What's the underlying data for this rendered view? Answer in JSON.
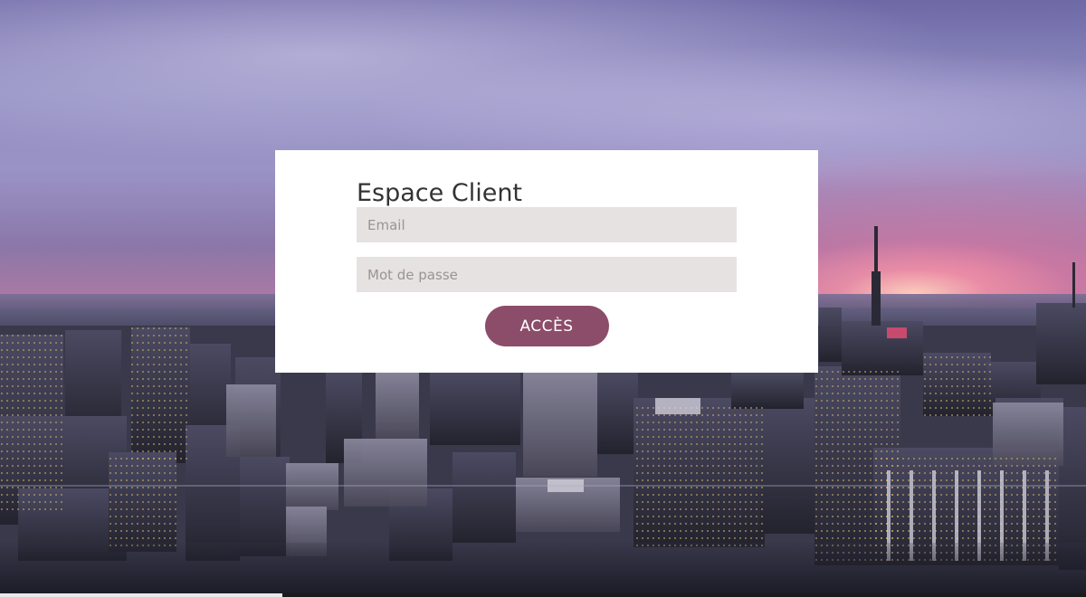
{
  "login": {
    "title": "Espace Client",
    "email": {
      "value": "",
      "placeholder": "Email"
    },
    "password": {
      "value": "",
      "placeholder": "Mot de passe"
    },
    "submit_label": "ACCÈS"
  },
  "colors": {
    "card_background": "#ffffff",
    "input_background": "#e6e2e2",
    "button_background": "#8c4d6a",
    "button_text": "#ffffff",
    "title_text": "#333333"
  }
}
